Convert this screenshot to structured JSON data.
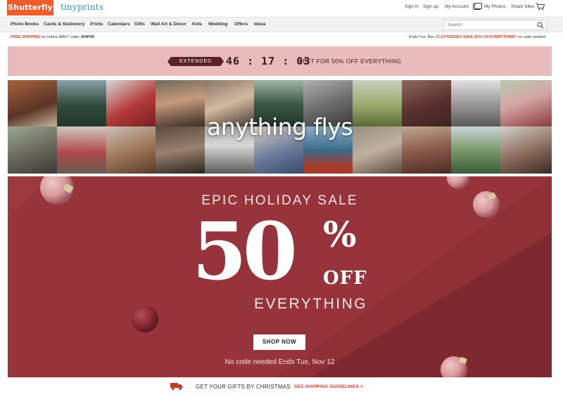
{
  "header": {
    "logo_primary": "Shutterfly",
    "logo_secondary": "tinyprints",
    "util_links": [
      "Sign in",
      "Sign up",
      "My Account",
      "My Photos",
      "Share Sites"
    ],
    "cart_icon": "cart-icon",
    "photos_icon": "photos-icon"
  },
  "nav": {
    "items": [
      "Photo Books",
      "Cards & Stationery",
      "Prints",
      "Calendars",
      "Gifts",
      "Wall Art & Décor",
      "Kids",
      "Wedding",
      "Offers",
      "Ideas"
    ],
    "search_placeholder": "Search"
  },
  "promo": {
    "left_bold": "FREE SHIPPING",
    "left_text": " on orders $49+* code: ",
    "left_code": "SHIP49",
    "right_text": "Ends Tue, Nov 12 ",
    "right_highlight": "EXTENDED SAVE 50% ON EVERYTHING*",
    "right_tail": " no code needed"
  },
  "countdown": {
    "tag": "EXTENDED",
    "timer": "46 : 17 : 03",
    "text": "LEFT FOR 50% OFF EVERYTHING"
  },
  "collage": {
    "title": "anything flys"
  },
  "sale": {
    "eyebrow": "EPIC HOLIDAY SALE",
    "percent_number": "50",
    "percent_sign": "%",
    "off": "OFF",
    "everything": "EVERYTHING",
    "button": "SHOP NOW",
    "footnote": "No code needed   Ends Tue, Nov 12"
  },
  "bottom": {
    "text": "GET YOUR GIFTS BY CHRISTMAS",
    "link": "SEE SHIPPING GUIDELINES >"
  },
  "colors": {
    "brand_orange": "#f15a29",
    "brand_blue": "#2a93c8",
    "countdown_bg": "#e8bcbc",
    "sale_bg": "#97343b",
    "accent_red": "#e03a2a"
  }
}
